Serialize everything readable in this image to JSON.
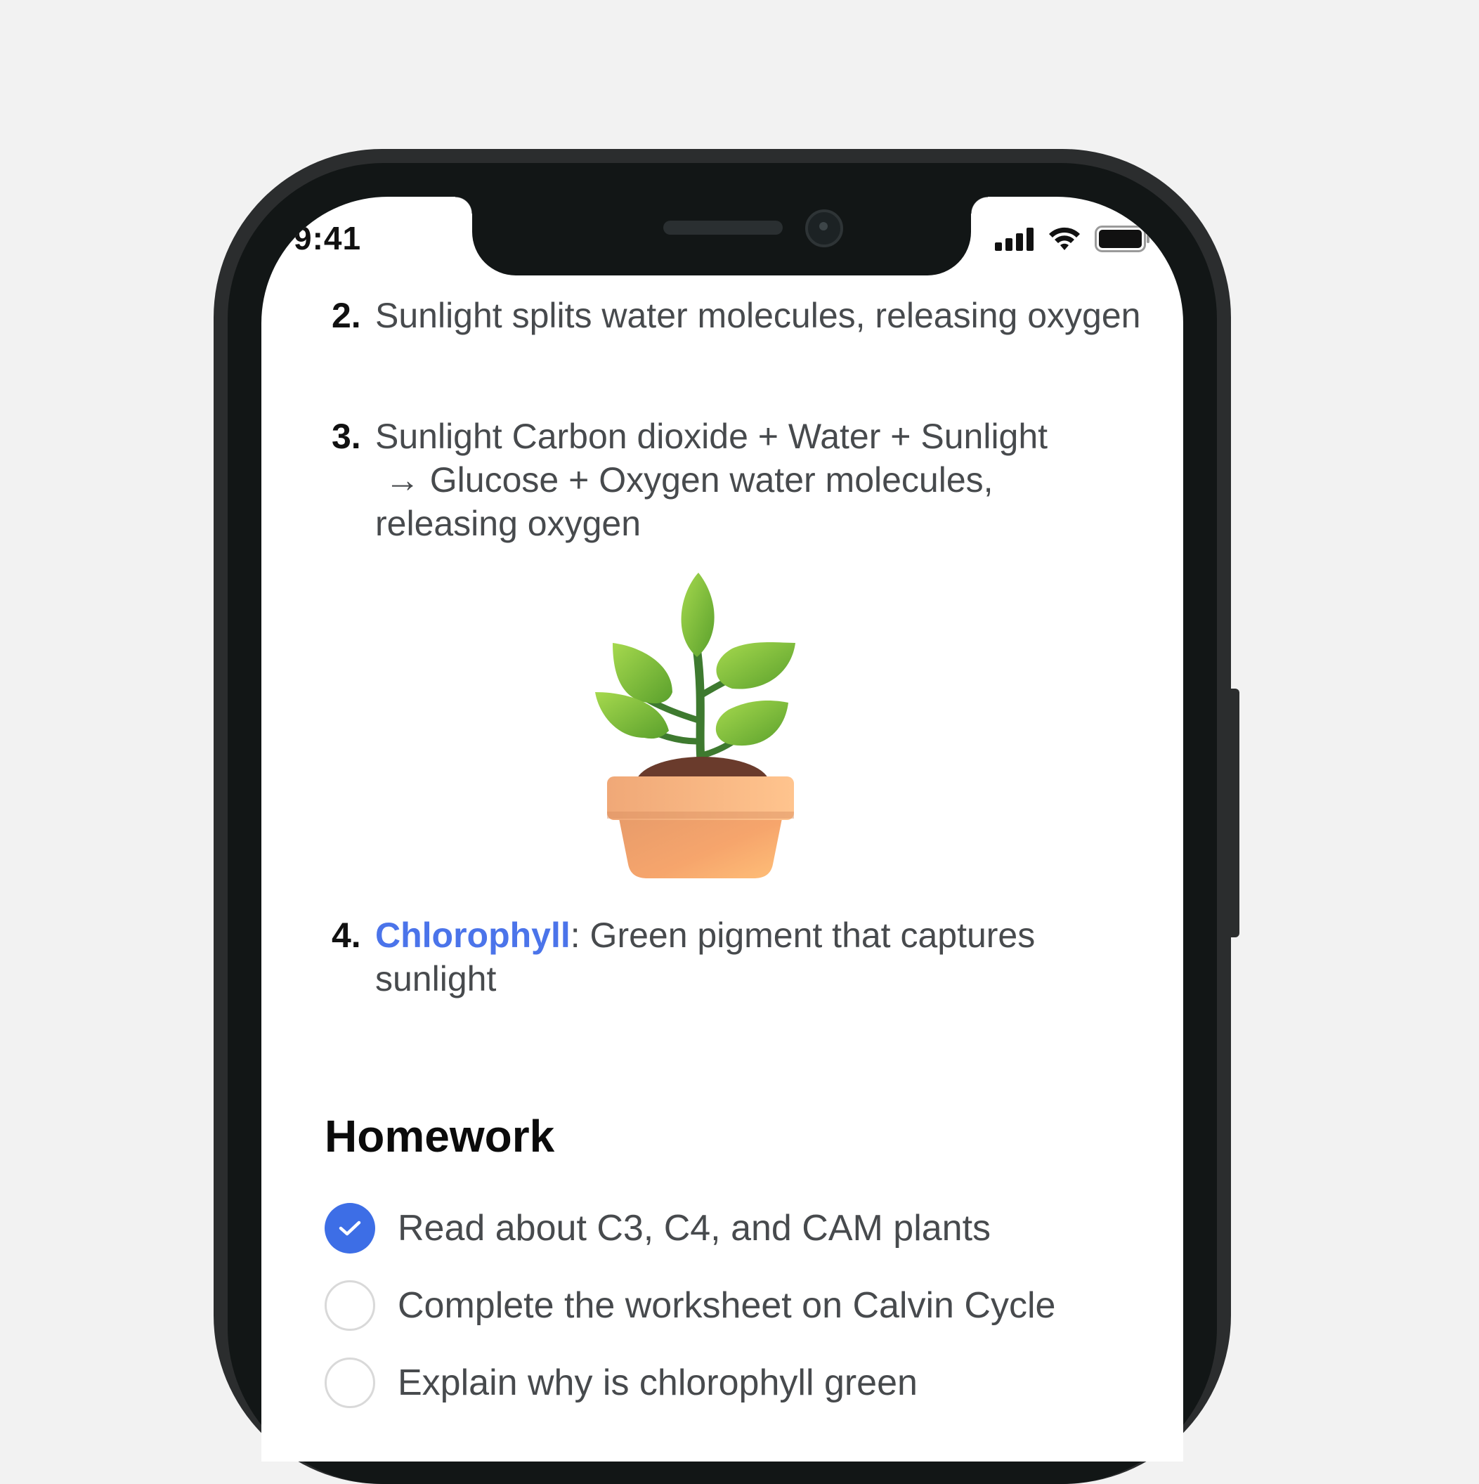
{
  "status_bar": {
    "time": "9:41",
    "icons": [
      "cellular-signal-icon",
      "wifi-icon",
      "battery-icon"
    ]
  },
  "steps": [
    {
      "number": "2.",
      "text": "Sunlight splits water molecules, releasing oxygen"
    },
    {
      "number": "3.",
      "text_line1": "Sunlight Carbon dioxide + Water + Sunlight",
      "text_line2": " → Glucose + Oxygen water molecules,",
      "text_line3": "releasing oxygen"
    },
    {
      "number": "4.",
      "term": "Chlorophyll",
      "definition": ": Green pigment that captures sunlight"
    }
  ],
  "illustration": {
    "icon": "potted-plant-icon"
  },
  "homework": {
    "title": "Homework",
    "tasks": [
      {
        "label": "Read about C3, C4, and CAM plants",
        "checked": true
      },
      {
        "label": "Complete the worksheet on Calvin Cycle",
        "checked": false
      },
      {
        "label": "Explain why is chlorophyll green",
        "checked": false
      }
    ]
  },
  "colors": {
    "accent": "#3d6ee6",
    "link": "#4b74ea",
    "text": "#474a4d",
    "background": "#f2f2f2"
  }
}
